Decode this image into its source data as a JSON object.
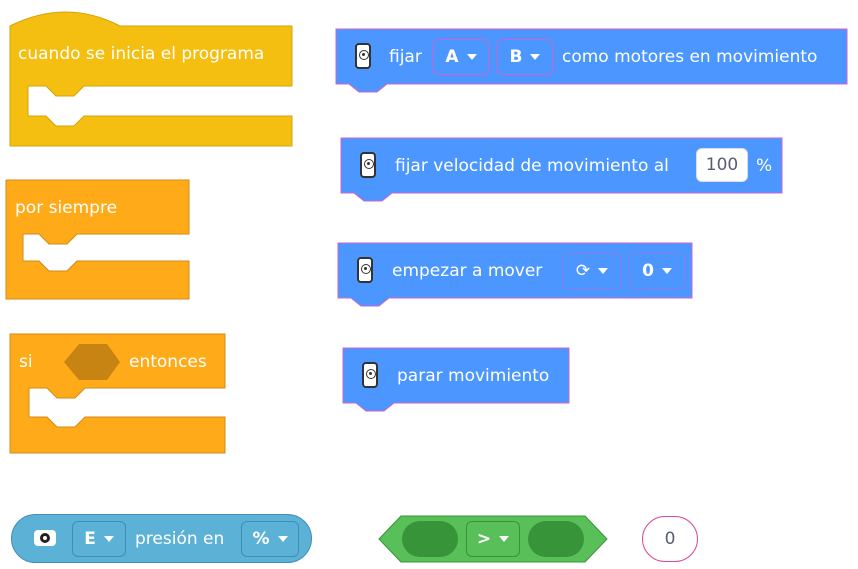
{
  "control": {
    "when_start": "cuando se inicia el programa",
    "forever": "por siempre",
    "if_label": "si",
    "then_label": "entonces"
  },
  "motors": {
    "set_pair": {
      "prefix": "fijar",
      "port_a": "A",
      "port_b": "B",
      "suffix": "como motores en movimiento"
    },
    "set_speed": {
      "prefix": "fijar velocidad de movimiento al",
      "value": "100",
      "unit": "%"
    },
    "start_move": {
      "label": "empezar a mover",
      "direction_glyph": "⟳",
      "steering": "0"
    },
    "stop_move": {
      "label": "parar movimiento"
    }
  },
  "sensor": {
    "port": "E",
    "label": "presión en",
    "unit": "%"
  },
  "operator": {
    "comparator": ">"
  },
  "reporter": {
    "value": "0"
  },
  "colors": {
    "events": "#f4bf10",
    "control": "#ffab19",
    "motors": "#4C97FF",
    "sensor": "#5cb1d6",
    "operators": "#59c059"
  }
}
